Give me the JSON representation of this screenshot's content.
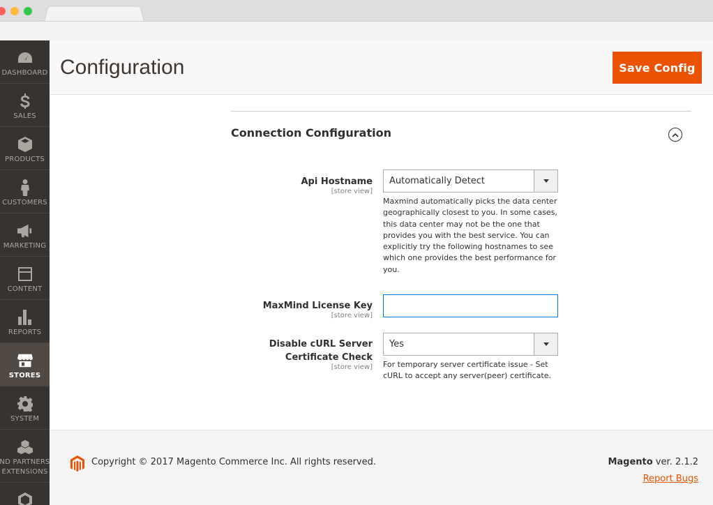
{
  "sidebar": {
    "items": [
      {
        "label": "DASHBOARD",
        "icon": "dashboard-icon",
        "active": false
      },
      {
        "label": "SALES",
        "icon": "dollar-icon",
        "active": false
      },
      {
        "label": "PRODUCTS",
        "icon": "box-icon",
        "active": false
      },
      {
        "label": "CUSTOMERS",
        "icon": "person-icon",
        "active": false
      },
      {
        "label": "MARKETING",
        "icon": "megaphone-icon",
        "active": false
      },
      {
        "label": "CONTENT",
        "icon": "layout-icon",
        "active": false
      },
      {
        "label": "REPORTS",
        "icon": "bar-chart-icon",
        "active": false
      },
      {
        "label": "STORES",
        "icon": "store-icon",
        "active": true
      },
      {
        "label": "SYSTEM",
        "icon": "gear-icon",
        "active": false
      },
      {
        "label_line1": "ND PARTNERS",
        "label_line2": "EXTENSIONS",
        "icon": "cubes-icon",
        "active": false
      }
    ]
  },
  "header": {
    "title": "Configuration",
    "save_label": "Save Config"
  },
  "section": {
    "title": "Connection Configuration"
  },
  "fields": {
    "api_hostname": {
      "label": "Api Hostname",
      "scope": "[store view]",
      "value": "Automatically Detect",
      "note": "Maxmind automatically picks the data center geographically closest to you. In some cases, this data center may not be the one that provides you with the best service. You can explicitly try the following hostnames to see which one provides the best performance for you."
    },
    "license_key": {
      "label": "MaxMind License Key",
      "scope": "[store view]",
      "value": ""
    },
    "disable_curl": {
      "label_line1": "Disable cURL Server",
      "label_line2": "Certificate Check",
      "scope": "[store view]",
      "value": "Yes",
      "note": "For temporary server certificate issue - Set cURL to accept any server(peer) certificate."
    }
  },
  "footer": {
    "copyright": "Copyright © 2017 Magento Commerce Inc. All rights reserved.",
    "brand": "Magento",
    "version": " ver. 2.1.2",
    "report_bugs": "Report Bugs"
  },
  "colors": {
    "accent": "#eb5202",
    "sidebar_bg": "#373330",
    "sidebar_active": "#514943"
  }
}
